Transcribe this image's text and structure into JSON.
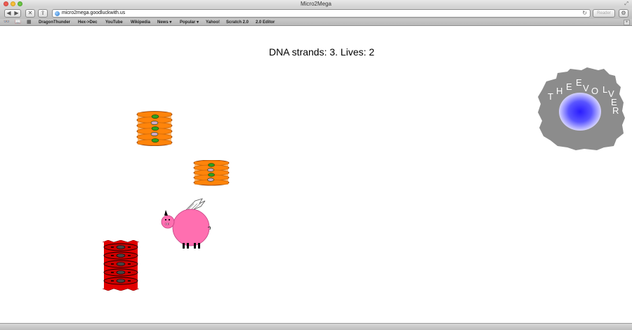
{
  "window": {
    "title": "Micro2Mega",
    "url": "micro2mega.goodluckwith.us",
    "reader_label": "Reader"
  },
  "bookmarks": [
    "DragonThunder",
    "Hex->Dec",
    "YouTube",
    "Wikipedia",
    "News ▾",
    "Popular ▾",
    "Yahoo!",
    "Scratch 2.0",
    "2.0 Editor"
  ],
  "game": {
    "status": "DNA strands: 3. Lives: 2",
    "dna_strands": 3,
    "lives": 2,
    "evolver_letters": [
      "T",
      "H",
      "E",
      "E",
      "V",
      "O",
      "L",
      "V",
      "E",
      "R"
    ]
  },
  "colors": {
    "orange_cell": "#ff7a00",
    "red_cell": "#e10000",
    "pig_pink": "#ff6fb0",
    "evolver_core": "#2a1cff",
    "evolver_body": "#8c8c8c"
  },
  "icons": {
    "back": "back-arrow-icon",
    "forward": "forward-arrow-icon",
    "stop": "close-icon",
    "share": "share-icon",
    "reload": "reload-icon",
    "prefs": "gear-icon"
  }
}
